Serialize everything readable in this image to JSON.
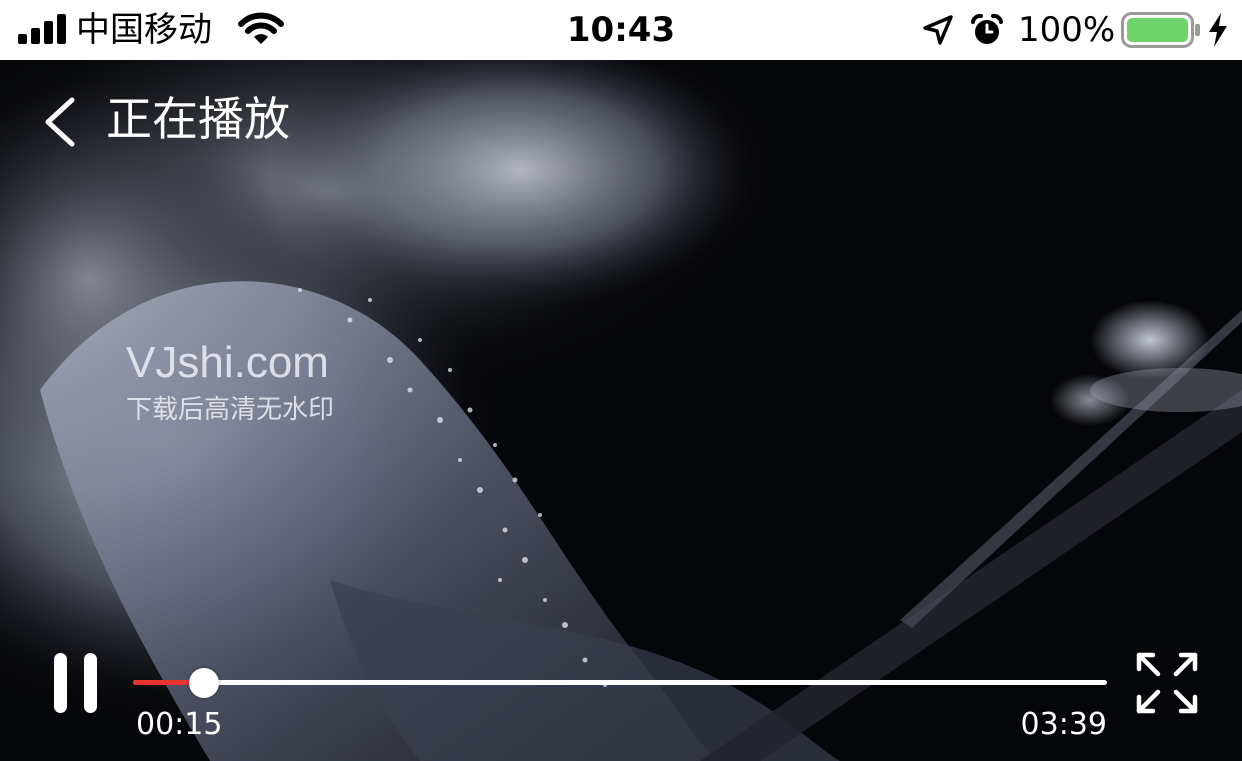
{
  "status_bar": {
    "carrier": "中国移动",
    "time": "10:43",
    "battery_percent": "100%",
    "battery_level": 1.0,
    "battery_color": "#6fd469",
    "icons": [
      "signal-bars-icon",
      "wifi-icon",
      "location-arrow-icon",
      "alarm-icon",
      "battery-icon",
      "charging-bolt-icon"
    ]
  },
  "header": {
    "back_icon": "chevron-left-icon",
    "title": "正在播放"
  },
  "video": {
    "watermark_site": "VJshi.com",
    "watermark_note": "下载后高清无水印"
  },
  "player": {
    "state_icon": "pause-icon",
    "current_time": "00:15",
    "total_time": "03:39",
    "progress": 0.073,
    "progress_color": "#e8332f",
    "fullscreen_icon": "expand-arrows-icon"
  }
}
